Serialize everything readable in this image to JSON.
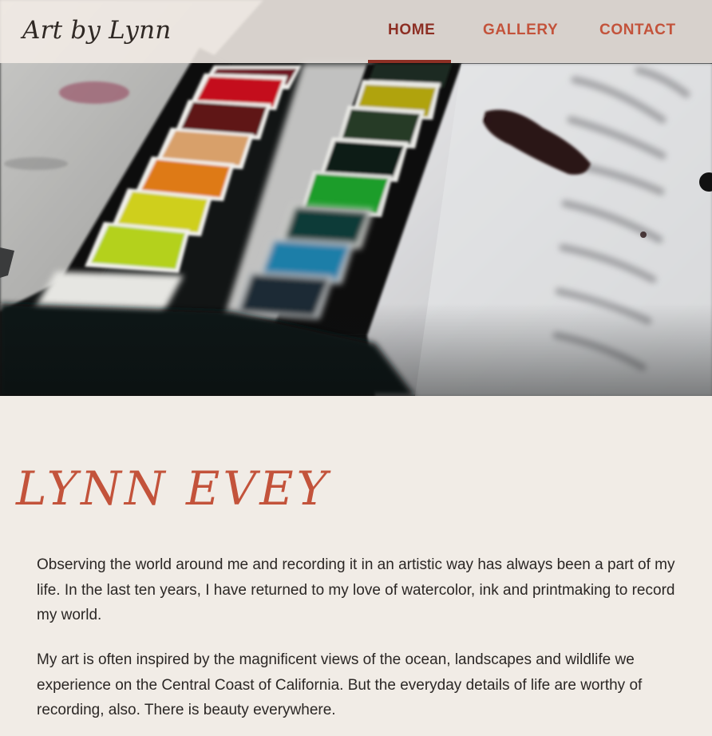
{
  "header": {
    "logo": "Art by Lynn",
    "nav": [
      {
        "label": "HOME",
        "active": true
      },
      {
        "label": "GALLERY",
        "active": false
      },
      {
        "label": "CONTACT",
        "active": false
      }
    ]
  },
  "hero": {
    "image": "watercolor-paint-palette-photo"
  },
  "main": {
    "title": "LYNN EVEY",
    "paragraphs": [
      "Observing the world around me and recording it in an artistic way has always been a part of my life. In the last ten years, I have returned to my love of watercolor, ink and printmaking to record my world.",
      "My art is often inspired by the magnificent views of the ocean, landscapes and wildlife we experience on the Central Coast of California. But the everyday details of life are worthy of recording, also. There is beauty everywhere."
    ]
  },
  "colors": {
    "background": "#f1ece6",
    "accent": "#c3533b",
    "accent_dark": "#8d2f24",
    "text": "#2b2725",
    "logo": "#2f2824"
  }
}
